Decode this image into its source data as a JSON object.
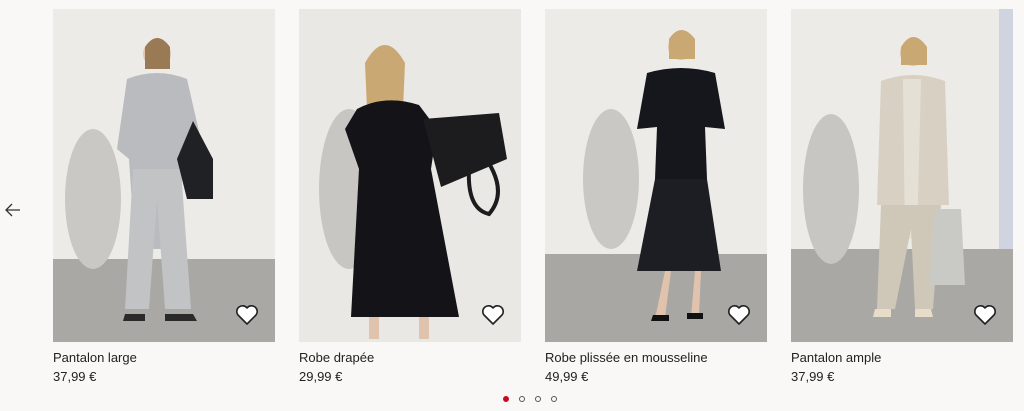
{
  "navigation": {
    "previous_icon": "arrow-left-icon"
  },
  "products": [
    {
      "name": "Pantalon large",
      "price": "37,99 €",
      "favorite_icon": "heart-outline-icon"
    },
    {
      "name": "Robe drapée",
      "price": "29,99 €",
      "favorite_icon": "heart-outline-icon"
    },
    {
      "name": "Robe plissée en mousseline",
      "price": "49,99 €",
      "favorite_icon": "heart-outline-icon"
    },
    {
      "name": "Pantalon ample",
      "price": "37,99 €",
      "favorite_icon": "heart-outline-icon"
    }
  ],
  "pagination": {
    "pages": 4,
    "active_page": 1,
    "active_color": "#cc071e"
  },
  "colors": {
    "background": "#f9f8f6",
    "text": "#222222"
  }
}
